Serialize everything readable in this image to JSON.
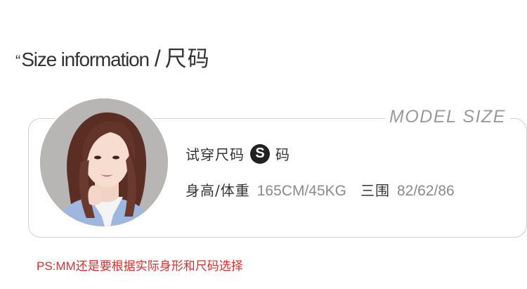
{
  "heading": {
    "quote_mark": "“",
    "title_en": "Size information",
    "slash": "/",
    "title_cn": "尺码"
  },
  "card": {
    "model_label": "MODEL SIZE",
    "try_size_label_prefix": "试穿尺码",
    "try_size_value": "S",
    "try_size_label_suffix": "码",
    "height_weight_label": "身高/体重",
    "height_weight_value": "165CM/45KG",
    "measurements_label": "三围",
    "measurements_value": "82/62/86"
  },
  "note": {
    "prefix": "PS:MM",
    "text": "还是要根据实际身形和尺码选择"
  },
  "colors": {
    "note_red": "#e0292c",
    "badge_black": "#222222",
    "border_gray": "#cfcfcf",
    "muted_gray": "#8a8a8a"
  }
}
